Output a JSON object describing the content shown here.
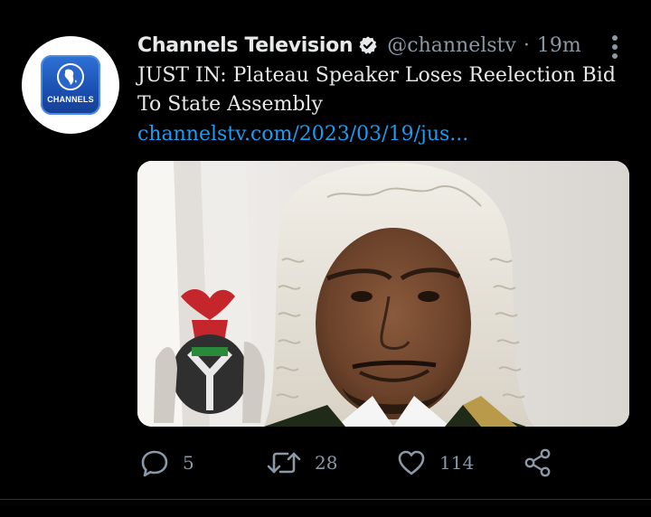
{
  "tweet": {
    "author_name": "Channels Television",
    "handle": "@channelstv",
    "separator": "·",
    "time": "19m",
    "text": "JUST IN: Plateau Speaker Loses Reelection Bid To State Assembly",
    "link": "channelstv.com/2023/03/19/jus...",
    "avatar_logo_text": "CHANNELS",
    "verified": true
  },
  "actions": {
    "replies": "5",
    "retweets": "28",
    "likes": "114"
  },
  "icons": {
    "more": "more-vertical-icon",
    "reply": "reply-icon",
    "retweet": "retweet-icon",
    "like": "heart-icon",
    "share": "share-icon",
    "verified": "verified-badge-icon"
  },
  "colors": {
    "background": "#000000",
    "text": "#e7e9ea",
    "muted": "#8b98a5",
    "link": "#1d9bf0",
    "brand_blue": "#1a4fb0"
  }
}
